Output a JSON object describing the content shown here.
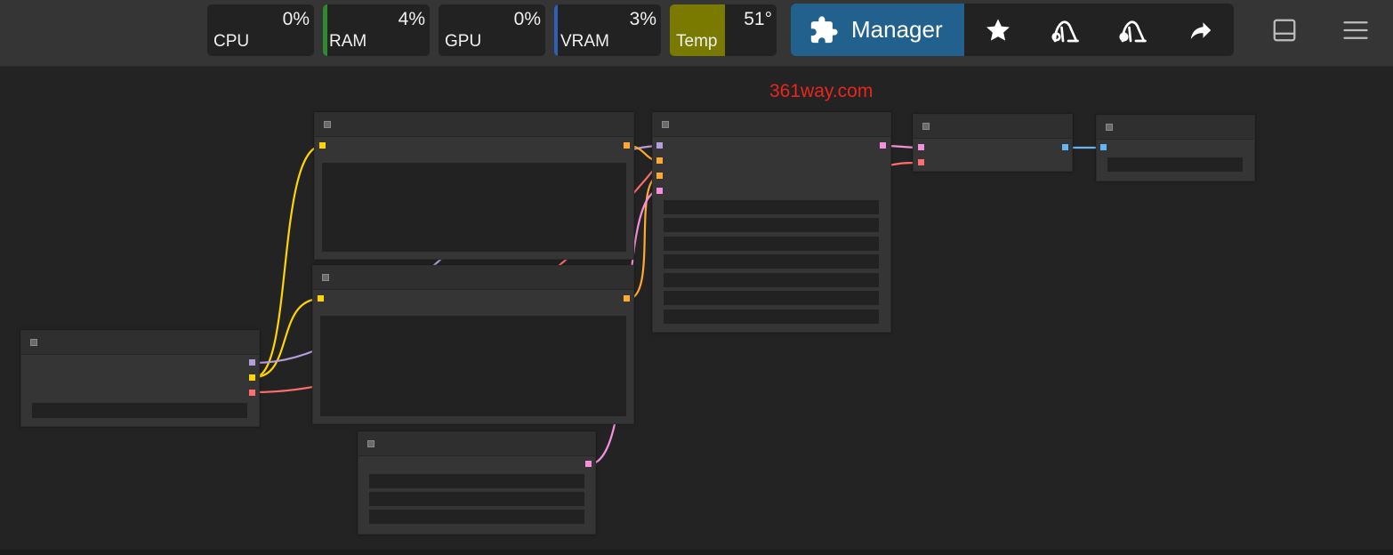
{
  "monitors": [
    {
      "label": "CPU",
      "value": "0%"
    },
    {
      "label": "RAM",
      "value": "4%"
    },
    {
      "label": "GPU",
      "value": "0%"
    },
    {
      "label": "VRAM",
      "value": "3%"
    },
    {
      "label": "Temp",
      "value": "51°"
    }
  ],
  "colors": {
    "ram_bar": "#2f8a2f",
    "vram_bar": "#2b62b8",
    "temp_bar": "#7a7a00",
    "manager_bg": "#22618e",
    "link_yellow": "#ffd500",
    "link_purple": "#b39ddb",
    "link_orange": "#ffa931",
    "link_pink": "#f48fdc",
    "link_red": "#ff6e6e",
    "link_blue": "#64b5f6",
    "watermark": "#e8261d"
  },
  "toolbar": {
    "manager_label": "Manager",
    "icons": [
      "puzzle-icon",
      "star-icon",
      "vacuum-icon",
      "vacuum-full-icon",
      "share-icon"
    ]
  },
  "side_icons": [
    "panel-toggle-icon",
    "menu-icon"
  ],
  "watermark": "361way.com"
}
